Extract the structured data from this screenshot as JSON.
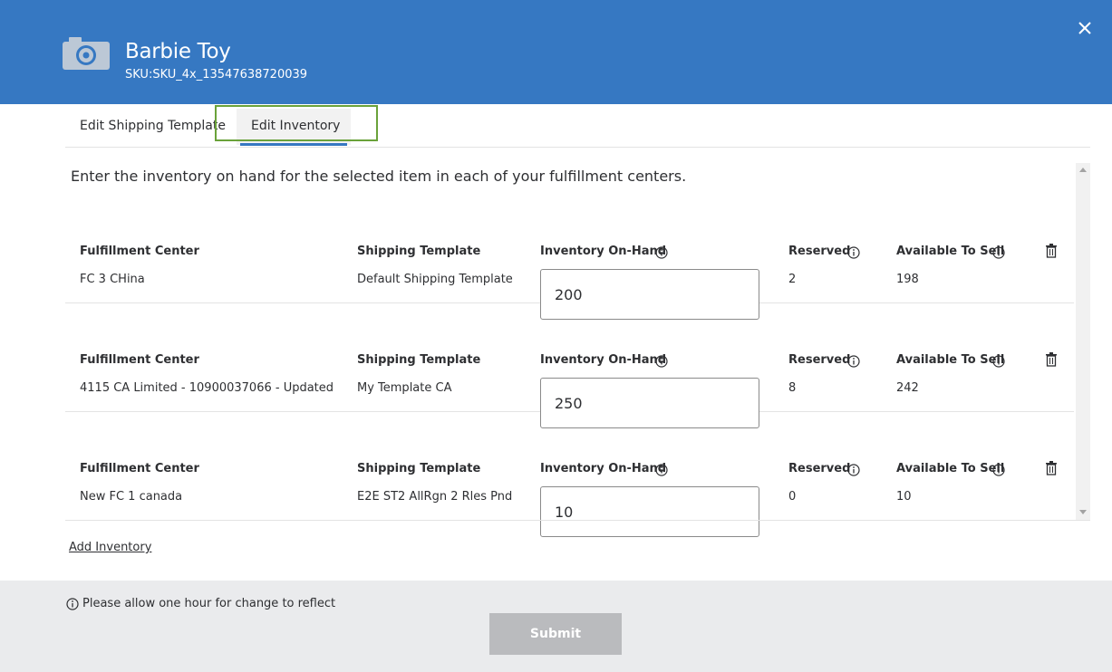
{
  "header": {
    "title": "Barbie Toy",
    "sku": "SKU:SKU_4x_13547638720039",
    "bg_color": "#3678c2",
    "image_icon": "camera-icon",
    "close_icon": "close-icon"
  },
  "tabs": [
    {
      "label": "Edit Shipping Template",
      "active": false
    },
    {
      "label": "Edit Inventory",
      "active": true
    }
  ],
  "intro": "Enter the inventory on hand for the selected item in each of your fulfillment centers.",
  "columns": {
    "fulfillment_center": "Fulfillment Center",
    "shipping_template": "Shipping Template",
    "inventory_on_hand": "Inventory On-Hand",
    "reserved": "Reserved",
    "available_to_sell": "Available To Sell"
  },
  "rows": [
    {
      "fulfillment_center": "FC 3 CHina",
      "shipping_template": "Default Shipping Template",
      "inventory_on_hand": "200",
      "reserved": "2",
      "available_to_sell": "198"
    },
    {
      "fulfillment_center": "4115 CA Limited - 10900037066 - Updated",
      "shipping_template": "My Template CA",
      "inventory_on_hand": "250",
      "reserved": "8",
      "available_to_sell": "242"
    },
    {
      "fulfillment_center": "New FC 1 canada",
      "shipping_template": "E2E ST2 AllRgn 2 Rles Pnd",
      "inventory_on_hand": "10",
      "reserved": "0",
      "available_to_sell": "10"
    }
  ],
  "add_inventory_label": "Add Inventory",
  "footer": {
    "note": "Please allow one hour for change to reflect",
    "submit_label": "Submit"
  }
}
